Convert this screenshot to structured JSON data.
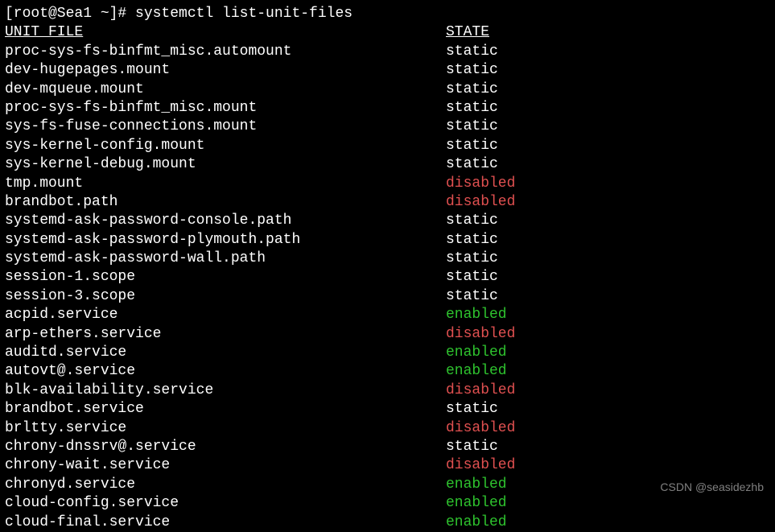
{
  "prompt_line": "[root@Sea1 ~]# systemctl list-unit-files",
  "header": {
    "unit": "UNIT FILE",
    "state": "STATE"
  },
  "rows": [
    {
      "unit": "proc-sys-fs-binfmt_misc.automount",
      "state": "static"
    },
    {
      "unit": "dev-hugepages.mount",
      "state": "static"
    },
    {
      "unit": "dev-mqueue.mount",
      "state": "static"
    },
    {
      "unit": "proc-sys-fs-binfmt_misc.mount",
      "state": "static"
    },
    {
      "unit": "sys-fs-fuse-connections.mount",
      "state": "static"
    },
    {
      "unit": "sys-kernel-config.mount",
      "state": "static"
    },
    {
      "unit": "sys-kernel-debug.mount",
      "state": "static"
    },
    {
      "unit": "tmp.mount",
      "state": "disabled"
    },
    {
      "unit": "brandbot.path",
      "state": "disabled"
    },
    {
      "unit": "systemd-ask-password-console.path",
      "state": "static"
    },
    {
      "unit": "systemd-ask-password-plymouth.path",
      "state": "static"
    },
    {
      "unit": "systemd-ask-password-wall.path",
      "state": "static"
    },
    {
      "unit": "session-1.scope",
      "state": "static"
    },
    {
      "unit": "session-3.scope",
      "state": "static"
    },
    {
      "unit": "acpid.service",
      "state": "enabled"
    },
    {
      "unit": "arp-ethers.service",
      "state": "disabled"
    },
    {
      "unit": "auditd.service",
      "state": "enabled"
    },
    {
      "unit": "autovt@.service",
      "state": "enabled"
    },
    {
      "unit": "blk-availability.service",
      "state": "disabled"
    },
    {
      "unit": "brandbot.service",
      "state": "static"
    },
    {
      "unit": "brltty.service",
      "state": "disabled"
    },
    {
      "unit": "chrony-dnssrv@.service",
      "state": "static"
    },
    {
      "unit": "chrony-wait.service",
      "state": "disabled"
    },
    {
      "unit": "chronyd.service",
      "state": "enabled"
    },
    {
      "unit": "cloud-config.service",
      "state": "enabled"
    },
    {
      "unit": "cloud-final.service",
      "state": "enabled"
    }
  ],
  "watermark": "CSDN @seasidezhb"
}
